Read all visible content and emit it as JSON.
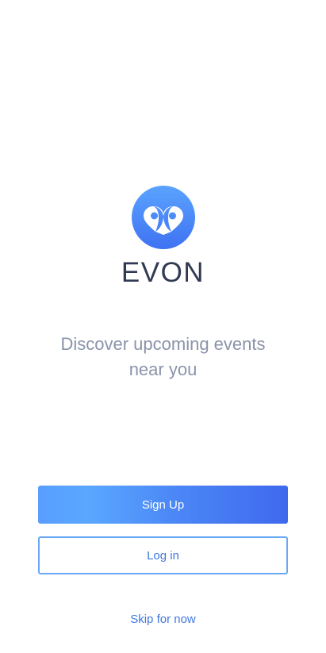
{
  "app": {
    "name": "EVON",
    "logo_icon": "map-pin-pair-icon",
    "tagline": "Discover upcoming events near you"
  },
  "actions": {
    "signup_label": "Sign Up",
    "login_label": "Log in",
    "skip_label": "Skip for now"
  },
  "colors": {
    "brand_blue": "#4b87f6",
    "brand_dark": "#303a52",
    "tagline_gray": "#8a93aa",
    "link_blue": "#3f78e0"
  }
}
